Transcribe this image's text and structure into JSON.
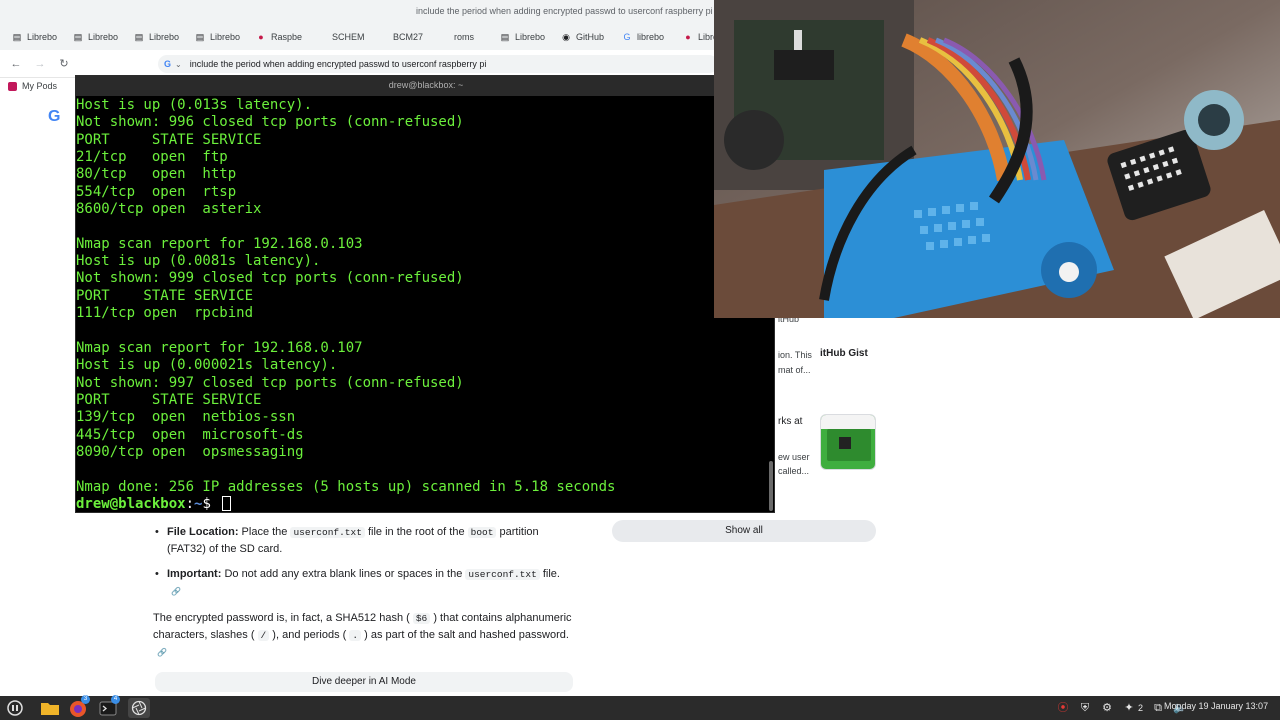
{
  "browser": {
    "window_title": "include the period when adding encrypted passwd to userconf raspberry pi",
    "tabs": [
      {
        "label": "Librebo",
        "icon": "document-icon"
      },
      {
        "label": "Librebo",
        "icon": "document-icon"
      },
      {
        "label": "Librebo",
        "icon": "document-icon"
      },
      {
        "label": "Librebo",
        "icon": "document-icon"
      },
      {
        "label": "Raspbe",
        "icon": "raspberry-icon"
      },
      {
        "label": "SCHEM",
        "icon": ""
      },
      {
        "label": "BCM27",
        "icon": ""
      },
      {
        "label": "roms",
        "icon": ""
      },
      {
        "label": "Librebo",
        "icon": "document-icon"
      },
      {
        "label": "GitHub",
        "icon": "github-icon"
      },
      {
        "label": "librebo",
        "icon": "google-icon"
      },
      {
        "label": "Libre",
        "icon": "raspberry-icon"
      }
    ],
    "address": "include the period when adding encrypted passwd to userconf raspberry pi",
    "bookmark": "My Pods"
  },
  "sidebar": {
    "card1_header": "itHub",
    "card1_snippet": "ion. This mat of...",
    "card1_source": "itHub Gist",
    "card2_title": "rks at",
    "card2_snippet": "ew user called...",
    "show_all": "Show all"
  },
  "answer": {
    "bullet1_label": "File Location:",
    "bullet1_text_a": " Place the ",
    "bullet1_code_a": "userconf.txt",
    "bullet1_text_b": " file in the root of the ",
    "bullet1_code_b": "boot",
    "bullet1_text_c": " partition (FAT32) of the SD card.",
    "bullet2_label": "Important:",
    "bullet2_text_a": " Do not add any extra blank lines or spaces in the ",
    "bullet2_code_a": "userconf.txt",
    "bullet2_text_b": " file.",
    "para_a": "The encrypted password is, in fact, a SHA512 hash ( ",
    "para_code_a": "$6",
    "para_b": " ) that contains alphanumeric characters, slashes ( ",
    "para_code_b": "/",
    "para_c": " ), and periods ( ",
    "para_code_c": ".",
    "para_d": " ) as part of the salt and hashed password.",
    "dive_button": "Dive deeper in AI Mode"
  },
  "terminal": {
    "title": "drew@blackbox: ~",
    "lines": [
      "Host is up (0.013s latency).",
      "Not shown: 996 closed tcp ports (conn-refused)",
      "PORT     STATE SERVICE",
      "21/tcp   open  ftp",
      "80/tcp   open  http",
      "554/tcp  open  rtsp",
      "8600/tcp open  asterix",
      "",
      "Nmap scan report for 192.168.0.103",
      "Host is up (0.0081s latency).",
      "Not shown: 999 closed tcp ports (conn-refused)",
      "PORT    STATE SERVICE",
      "111/tcp open  rpcbind",
      "",
      "Nmap scan report for 192.168.0.107",
      "Host is up (0.000021s latency).",
      "Not shown: 997 closed tcp ports (conn-refused)",
      "PORT     STATE SERVICE",
      "139/tcp  open  netbios-ssn",
      "445/tcp  open  microsoft-ds",
      "8090/tcp open  opsmessaging",
      "",
      "Nmap done: 256 IP addresses (5 hosts up) scanned in 5.18 seconds"
    ],
    "prompt_user": "drew@blackbox",
    "prompt_sep": ":",
    "prompt_path": "~",
    "prompt_symbol": "$ "
  },
  "taskbar": {
    "firefox_badge": "3",
    "terminal_badge": "4",
    "tray_count": "2",
    "clock": "Monday 19 January 13:07"
  },
  "colors": {
    "terminal_green": "#6cf03c",
    "terminal_bg": "#000000",
    "prompt_path_blue": "#5b8bd8",
    "taskbar_bg": "#2b2b2b"
  }
}
